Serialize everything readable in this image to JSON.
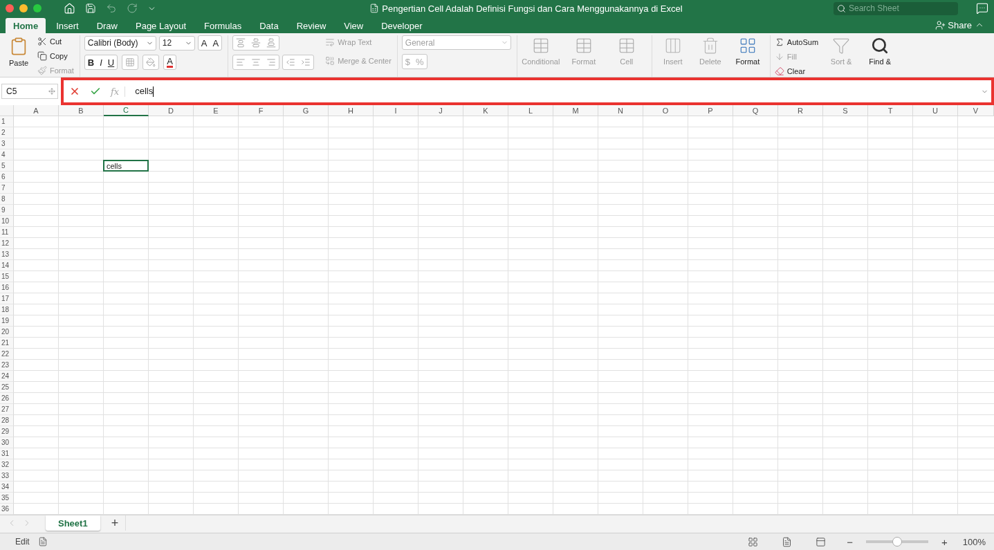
{
  "window": {
    "title": "Pengertian Cell Adalah Definisi Fungsi dan Cara Menggunakannya di Excel",
    "search": {
      "placeholder": "Search Sheet"
    }
  },
  "tabs": [
    {
      "label": "Home",
      "selected": true
    },
    {
      "label": "Insert",
      "selected": false
    },
    {
      "label": "Draw",
      "selected": false
    },
    {
      "label": "Page Layout",
      "selected": false
    },
    {
      "label": "Formulas",
      "selected": false
    },
    {
      "label": "Data",
      "selected": false
    },
    {
      "label": "Review",
      "selected": false
    },
    {
      "label": "View",
      "selected": false
    },
    {
      "label": "Developer",
      "selected": false
    }
  ],
  "share": {
    "label": "Share"
  },
  "ribbon": {
    "clipboard": {
      "paste": "Paste",
      "items": [
        {
          "label": "Cut",
          "disabled": false
        },
        {
          "label": "Copy",
          "disabled": false
        },
        {
          "label": "Format",
          "disabled": true
        }
      ]
    },
    "font": {
      "name": "Calibri (Body)",
      "size": "12",
      "grow": "A",
      "shrink": "A",
      "bold": "B",
      "italic": "I",
      "underline": "U",
      "color_letter": "A"
    },
    "alignment": {
      "wrap": {
        "label": "Wrap Text",
        "disabled": true
      },
      "merge": {
        "label": "Merge & Center",
        "disabled": true
      }
    },
    "number": {
      "format": "General",
      "disabled": true,
      "currency": "$",
      "percent": "%"
    },
    "styles": [
      {
        "label": "Conditional",
        "disabled": true
      },
      {
        "label": "Format",
        "disabled": true
      },
      {
        "label": "Cell",
        "disabled": true
      }
    ],
    "cells": [
      {
        "label": "Insert",
        "disabled": true
      },
      {
        "label": "Delete",
        "disabled": true
      },
      {
        "label": "Format",
        "disabled": false
      }
    ],
    "editing": {
      "autosum": {
        "label": "AutoSum",
        "disabled": false
      },
      "fill": {
        "label": "Fill",
        "disabled": true
      },
      "clear": {
        "label": "Clear",
        "disabled": false
      },
      "sort": {
        "label": "Sort &",
        "disabled": true
      },
      "find": {
        "label": "Find &",
        "disabled": false
      }
    }
  },
  "formula_bar": {
    "name_box": "C5",
    "function_label": "fx",
    "value": "cells",
    "highlighted": true
  },
  "grid": {
    "columns": [
      {
        "label": "A",
        "selected": false
      },
      {
        "label": "B",
        "selected": false
      },
      {
        "label": "C",
        "selected": true
      },
      {
        "label": "D",
        "selected": false
      },
      {
        "label": "E",
        "selected": false
      },
      {
        "label": "F",
        "selected": false
      },
      {
        "label": "G",
        "selected": false
      },
      {
        "label": "H",
        "selected": false
      },
      {
        "label": "I",
        "selected": false
      },
      {
        "label": "J",
        "selected": false
      },
      {
        "label": "K",
        "selected": false
      },
      {
        "label": "L",
        "selected": false
      },
      {
        "label": "M",
        "selected": false
      },
      {
        "label": "N",
        "selected": false
      },
      {
        "label": "O",
        "selected": false
      },
      {
        "label": "P",
        "selected": false
      },
      {
        "label": "Q",
        "selected": false
      },
      {
        "label": "R",
        "selected": false
      },
      {
        "label": "S",
        "selected": false
      },
      {
        "label": "T",
        "selected": false
      },
      {
        "label": "U",
        "selected": false
      },
      {
        "label": "V",
        "selected": false
      }
    ],
    "rows": [
      {
        "label": "1"
      },
      {
        "label": "2"
      },
      {
        "label": "3"
      },
      {
        "label": "4"
      },
      {
        "label": "5",
        "cells": [
          {
            "value": "cells",
            "selected": true
          }
        ]
      },
      {
        "label": "6"
      },
      {
        "label": "7"
      },
      {
        "label": "8"
      },
      {
        "label": "9"
      },
      {
        "label": "10"
      },
      {
        "label": "11"
      },
      {
        "label": "12"
      },
      {
        "label": "13"
      },
      {
        "label": "14"
      },
      {
        "label": "15"
      },
      {
        "label": "16"
      },
      {
        "label": "17"
      },
      {
        "label": "18"
      },
      {
        "label": "19"
      },
      {
        "label": "20"
      },
      {
        "label": "21"
      },
      {
        "label": "22"
      },
      {
        "label": "23"
      },
      {
        "label": "24"
      },
      {
        "label": "25"
      },
      {
        "label": "26"
      },
      {
        "label": "27"
      },
      {
        "label": "28"
      },
      {
        "label": "29"
      },
      {
        "label": "30"
      },
      {
        "label": "31"
      },
      {
        "label": "32"
      },
      {
        "label": "33"
      },
      {
        "label": "34"
      },
      {
        "label": "35"
      },
      {
        "label": "36"
      }
    ]
  },
  "sheets": [
    {
      "label": "Sheet1",
      "selected": true
    }
  ],
  "add_sheet": "+",
  "status_bar": {
    "mode": "Edit",
    "zoom": {
      "level": 0.5,
      "reading": "100%"
    },
    "zoom_out": "−",
    "zoom_in": "+"
  }
}
